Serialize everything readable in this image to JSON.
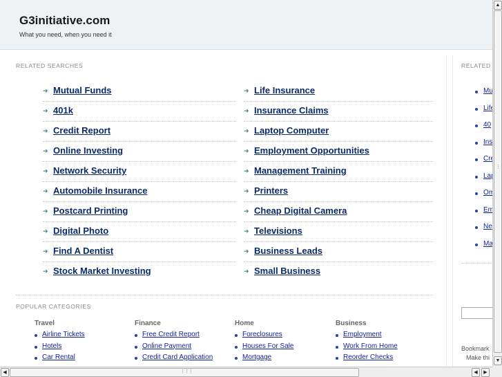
{
  "header": {
    "title": "G3initiative.com",
    "tagline": "What you need, when you need it"
  },
  "related": {
    "label": "RELATED SEARCHES",
    "left_links": [
      "Mutual Funds",
      "401k",
      "Credit Report",
      "Online Investing",
      "Network Security",
      "Automobile Insurance",
      "Postcard Printing",
      "Digital Photo",
      "Find A Dentist",
      "Stock Market Investing"
    ],
    "right_links": [
      "Life Insurance",
      "Insurance Claims",
      "Laptop Computer",
      "Employment Opportunities",
      "Management Training",
      "Printers",
      "Cheap Digital Camera",
      "Televisions",
      "Business Leads",
      "Small Business"
    ]
  },
  "popular": {
    "label": "POPULAR CATEGORIES",
    "categories": [
      {
        "title": "Travel",
        "items": [
          "Airline Tickets",
          "Hotels",
          "Car Rental"
        ]
      },
      {
        "title": "Finance",
        "items": [
          "Free Credit Report",
          "Online Payment",
          "Credit Card Application"
        ]
      },
      {
        "title": "Home",
        "items": [
          "Foreclosures",
          "Houses For Sale",
          "Mortgage"
        ]
      },
      {
        "title": "Business",
        "items": [
          "Employment",
          "Work From Home",
          "Reorder Checks"
        ]
      }
    ]
  },
  "sidebar": {
    "label": "RELATED",
    "items": [
      "Mu",
      "Life",
      "40",
      "Ins",
      "Cre",
      "Lap",
      "Om",
      "Em",
      "Ne",
      "Ma"
    ],
    "bookmark_text": "Bookmark",
    "make_text": "Make thi"
  },
  "icons": {
    "arrow": "right-arrow-icon",
    "scroll_up": "scroll-up-icon",
    "scroll_down": "scroll-down-icon",
    "scroll_left": "scroll-left-icon",
    "scroll_right": "scroll-right-icon"
  },
  "colors": {
    "link": "#0b2a6a",
    "arrow": "#3a8a8a",
    "header_bg": "#eef2f5"
  }
}
